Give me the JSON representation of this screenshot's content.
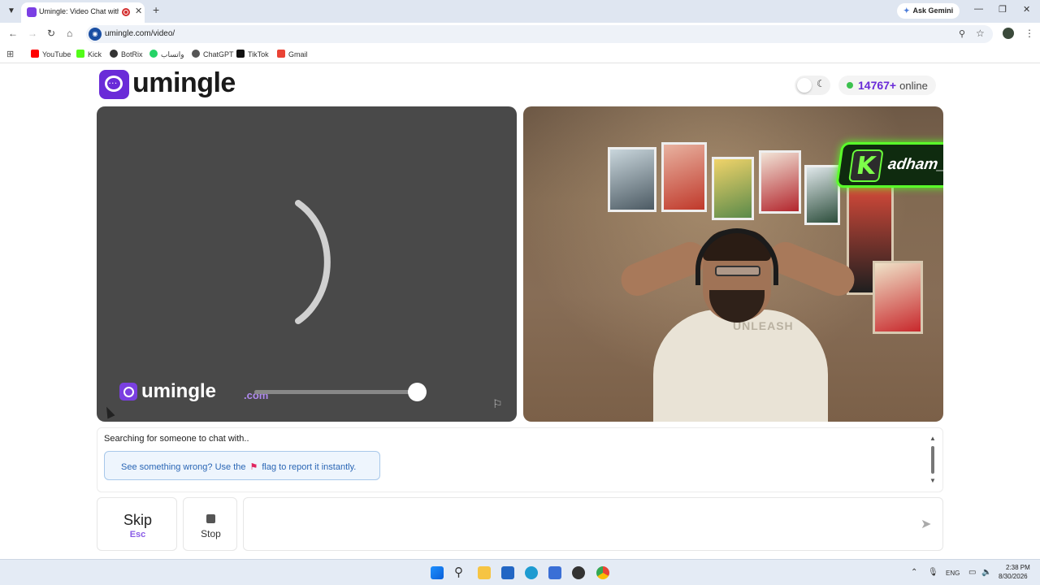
{
  "browser": {
    "tab_title": "Umingle: Video Chat with S",
    "url": "umingle.com/video/",
    "ask_gemini": "Ask Gemini",
    "bookmarks": [
      {
        "label": "YouTube",
        "color": "#ff0000"
      },
      {
        "label": "Kick",
        "color": "#53fc18"
      },
      {
        "label": "BotRix",
        "color": "#333333"
      },
      {
        "label": "واتساب",
        "color": "#25d366"
      },
      {
        "label": "ChatGPT",
        "color": "#555555"
      },
      {
        "label": "TikTok",
        "color": "#111111"
      },
      {
        "label": "Gmail",
        "color": "#ea4335"
      }
    ]
  },
  "header": {
    "logo_text": "umingle",
    "online_count": "14767+",
    "online_label": "online"
  },
  "left_video": {
    "watermark": "umingle",
    "watermark_domain": ".com",
    "volume_level": 0.99
  },
  "right_video": {
    "shirt_text": "UNLEASH",
    "badge_letter": "K",
    "badge_name": "adham_azab"
  },
  "chat": {
    "status": "Searching for someone to chat with..",
    "notice_before": "See something wrong? Use the",
    "notice_after": "flag to report it instantly."
  },
  "controls": {
    "skip_label": "Skip",
    "skip_key": "Esc",
    "stop_label": "Stop",
    "message_placeholder": ""
  },
  "taskbar": {
    "lang": "ENG",
    "time": "2:38 PM",
    "date": "8/30/2026"
  },
  "colors": {
    "brand": "#6a2bd8",
    "online": "#3cc14f",
    "notice_text": "#2a66b5"
  }
}
